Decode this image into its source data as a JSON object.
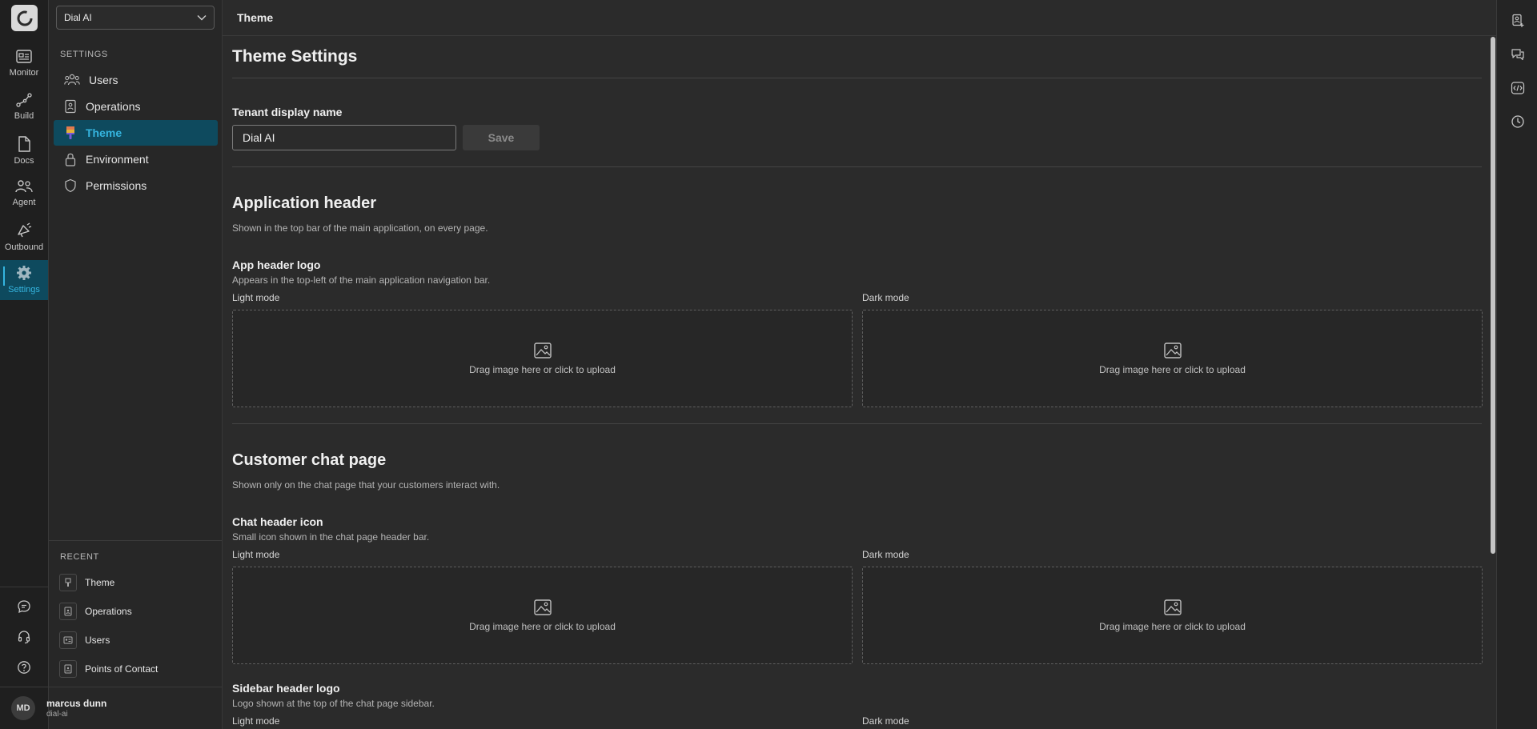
{
  "rail": {
    "items": [
      {
        "label": "Monitor"
      },
      {
        "label": "Build"
      },
      {
        "label": "Docs"
      },
      {
        "label": "Agent"
      },
      {
        "label": "Outbound"
      },
      {
        "label": "Settings"
      }
    ],
    "accent": "#35b5e0"
  },
  "sidebar": {
    "tenant": "Dial AI",
    "settings_heading": "SETTINGS",
    "items": [
      {
        "label": "Users"
      },
      {
        "label": "Operations"
      },
      {
        "label": "Theme"
      },
      {
        "label": "Environment"
      },
      {
        "label": "Permissions"
      }
    ],
    "recent_heading": "RECENT",
    "recent": [
      {
        "label": "Theme"
      },
      {
        "label": "Operations"
      },
      {
        "label": "Users"
      },
      {
        "label": "Points of Contact"
      }
    ],
    "user": {
      "initials": "MD",
      "name": "marcus dunn",
      "org": "dial-ai"
    }
  },
  "header": {
    "title": "Theme"
  },
  "main": {
    "title": "Theme Settings",
    "tenant_label": "Tenant display name",
    "tenant_value": "Dial AI",
    "save_label": "Save",
    "app_header": {
      "title": "Application header",
      "desc": "Shown in the top bar of the main application, on every page.",
      "logo_title": "App header logo",
      "logo_desc": "Appears in the top-left of the main application navigation bar."
    },
    "chat_page": {
      "title": "Customer chat page",
      "desc": "Shown only on the chat page that your customers interact with.",
      "icon_title": "Chat header icon",
      "icon_desc": "Small icon shown in the chat page header bar.",
      "sidebar_title": "Sidebar header logo",
      "sidebar_desc": "Logo shown at the top of the chat page sidebar."
    },
    "light_mode": "Light mode",
    "dark_mode": "Dark mode",
    "upload_text": "Drag image here or click to upload"
  }
}
